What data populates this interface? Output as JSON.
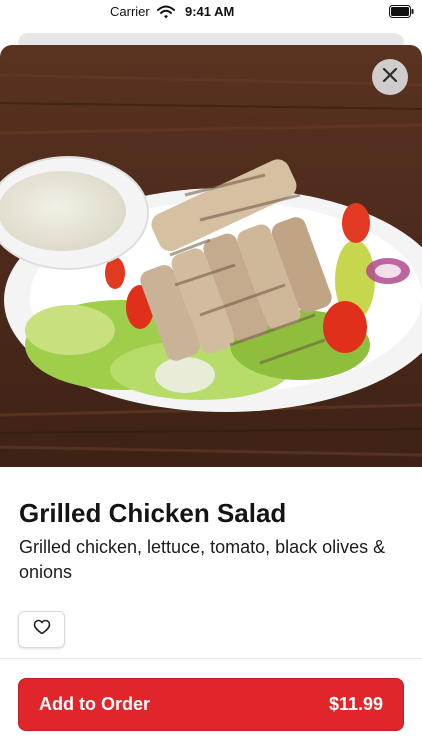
{
  "status_bar": {
    "carrier": "Carrier",
    "time": "9:41 AM",
    "icons": [
      "wifi-icon",
      "battery-icon"
    ]
  },
  "item": {
    "title": "Grilled Chicken Salad",
    "description": "Grilled chicken, lettuce, tomato, black olives & onions",
    "image_icon": "salad-photo"
  },
  "actions": {
    "close_icon": "close-icon",
    "favorite_icon": "heart-icon"
  },
  "footer": {
    "add_label": "Add to Order",
    "price": "$11.99"
  },
  "colors": {
    "accent": "#e0262a",
    "text": "#141414",
    "table": "#4a2a1a"
  }
}
